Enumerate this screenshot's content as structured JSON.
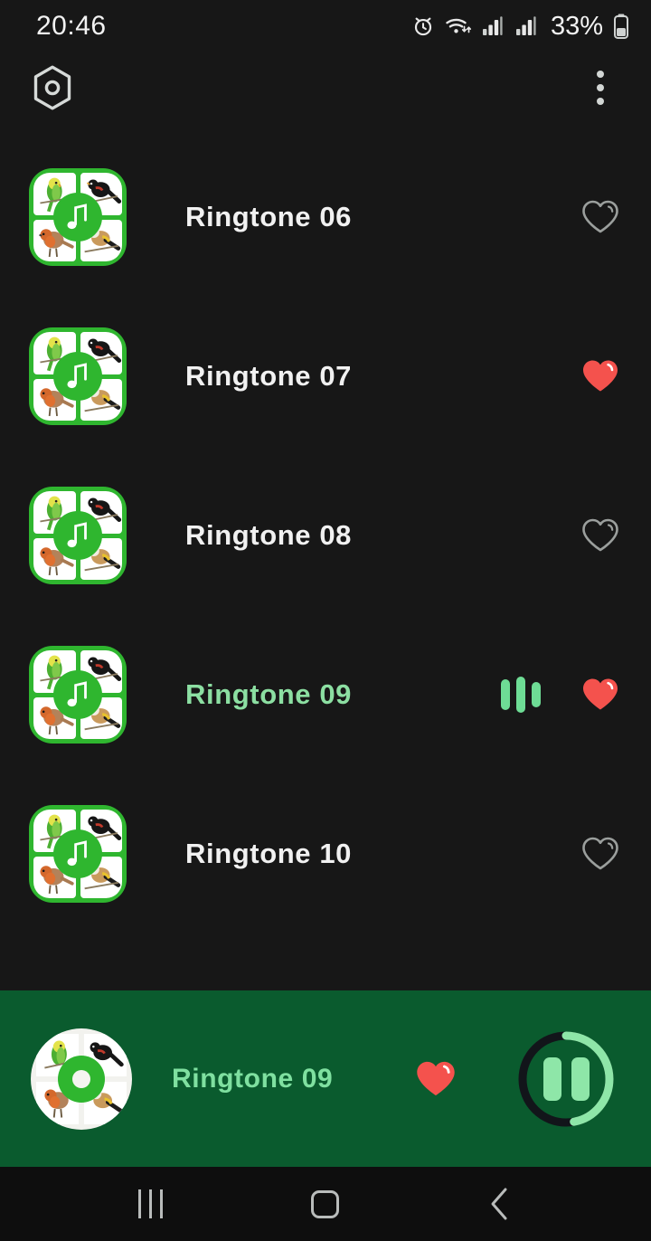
{
  "status_bar": {
    "time": "20:46",
    "battery_percent": "33%",
    "icons": [
      "alarm-icon",
      "wifi-icon",
      "signal-sim1-icon",
      "signal-sim2-icon",
      "battery-icon"
    ]
  },
  "app_bar": {
    "left_icon": "hexagon-settings-icon",
    "menu_icon": "overflow-menu-icon"
  },
  "theme": {
    "background": "#171717",
    "accent_green": "#2fb62f",
    "player_bg": "#0a5b2e",
    "playing_text": "#8cdfa2",
    "favorite_red": "#f4524d",
    "eq_green": "#6edc95",
    "text_primary": "#f1f1f1"
  },
  "tracks": [
    {
      "title": "Ringtone 06",
      "favorite": false,
      "playing": false,
      "thumbnail": "bird-grid-music-note-icon"
    },
    {
      "title": "Ringtone 07",
      "favorite": true,
      "playing": false,
      "thumbnail": "bird-grid-music-note-icon"
    },
    {
      "title": "Ringtone 08",
      "favorite": false,
      "playing": false,
      "thumbnail": "bird-grid-music-note-icon"
    },
    {
      "title": "Ringtone 09",
      "favorite": true,
      "playing": true,
      "thumbnail": "bird-grid-music-note-icon"
    },
    {
      "title": "Ringtone 10",
      "favorite": false,
      "playing": false,
      "thumbnail": "bird-grid-music-note-icon"
    }
  ],
  "player": {
    "title": "Ringtone 09",
    "favorite": true,
    "state": "playing",
    "control_icon": "pause-icon",
    "progress_percent": 47,
    "thumbnail": "bird-disc-icon"
  },
  "nav_bar": {
    "recents_label": "recents-icon",
    "home_label": "home-icon",
    "back_label": "back-icon"
  }
}
